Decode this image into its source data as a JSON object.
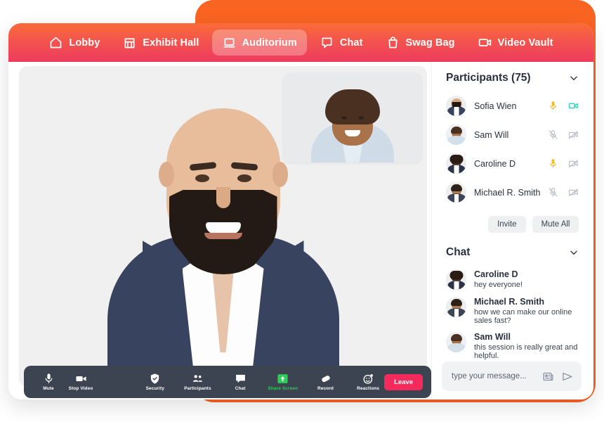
{
  "nav": {
    "items": [
      {
        "label": "Lobby",
        "icon": "home-icon",
        "active": false
      },
      {
        "label": "Exhibit Hall",
        "icon": "store-icon",
        "active": false
      },
      {
        "label": "Auditorium",
        "icon": "laptop-icon",
        "active": true
      },
      {
        "label": "Chat",
        "icon": "chat-bubble-icon",
        "active": false
      },
      {
        "label": "Swag Bag",
        "icon": "bag-icon",
        "active": false
      },
      {
        "label": "Video Vault",
        "icon": "video-camera-icon",
        "active": false
      }
    ]
  },
  "participants": {
    "title": "Participants (75)",
    "count": 75,
    "rows": [
      {
        "name": "Sofia Wien",
        "mic": "on",
        "cam": "on"
      },
      {
        "name": "Sam Will",
        "mic": "off",
        "cam": "off"
      },
      {
        "name": "Caroline D",
        "mic": "on",
        "cam": "off"
      },
      {
        "name": "Michael R. Smith",
        "mic": "off",
        "cam": "off"
      }
    ],
    "invite_label": "Invite",
    "mute_all_label": "Mute All"
  },
  "chat": {
    "title": "Chat",
    "messages": [
      {
        "name": "Caroline D",
        "text": "hey everyone!"
      },
      {
        "name": "Michael R. Smith",
        "text": "how we can make our online sales fast?"
      },
      {
        "name": "Sam Will",
        "text": "this session is really great and helpful."
      }
    ],
    "input_placeholder": "type your message...",
    "attach_icon": "news-attachment-icon",
    "send_icon": "send-icon"
  },
  "controls": {
    "items": [
      {
        "label": "Mute",
        "icon": "microphone-icon",
        "green": false
      },
      {
        "label": "Stop Video",
        "icon": "video-camera-icon",
        "green": false
      },
      {
        "label": "Security",
        "icon": "shield-check-icon",
        "green": false
      },
      {
        "label": "Participants",
        "icon": "people-icon",
        "green": false
      },
      {
        "label": "Chat",
        "icon": "chat-bubble-icon",
        "green": false
      },
      {
        "label": "Share Screen",
        "icon": "share-screen-icon",
        "green": true
      },
      {
        "label": "Record",
        "icon": "record-icon",
        "green": false
      },
      {
        "label": "Reactions",
        "icon": "reactions-icon",
        "green": false
      }
    ],
    "leave_label": "Leave"
  },
  "colors": {
    "backdrop_orange": "#FA6423",
    "nav_gradient_start": "#FA6B38",
    "nav_gradient_end": "#EE3B5E",
    "toolbar_dark": "#3C4451",
    "leave_red": "#F4295C",
    "mic_on_amber": "#F5B722",
    "cam_on_teal": "#1ECFB0",
    "icon_muted_gray": "#B9BEC7",
    "share_screen_green": "#2ECC58"
  }
}
